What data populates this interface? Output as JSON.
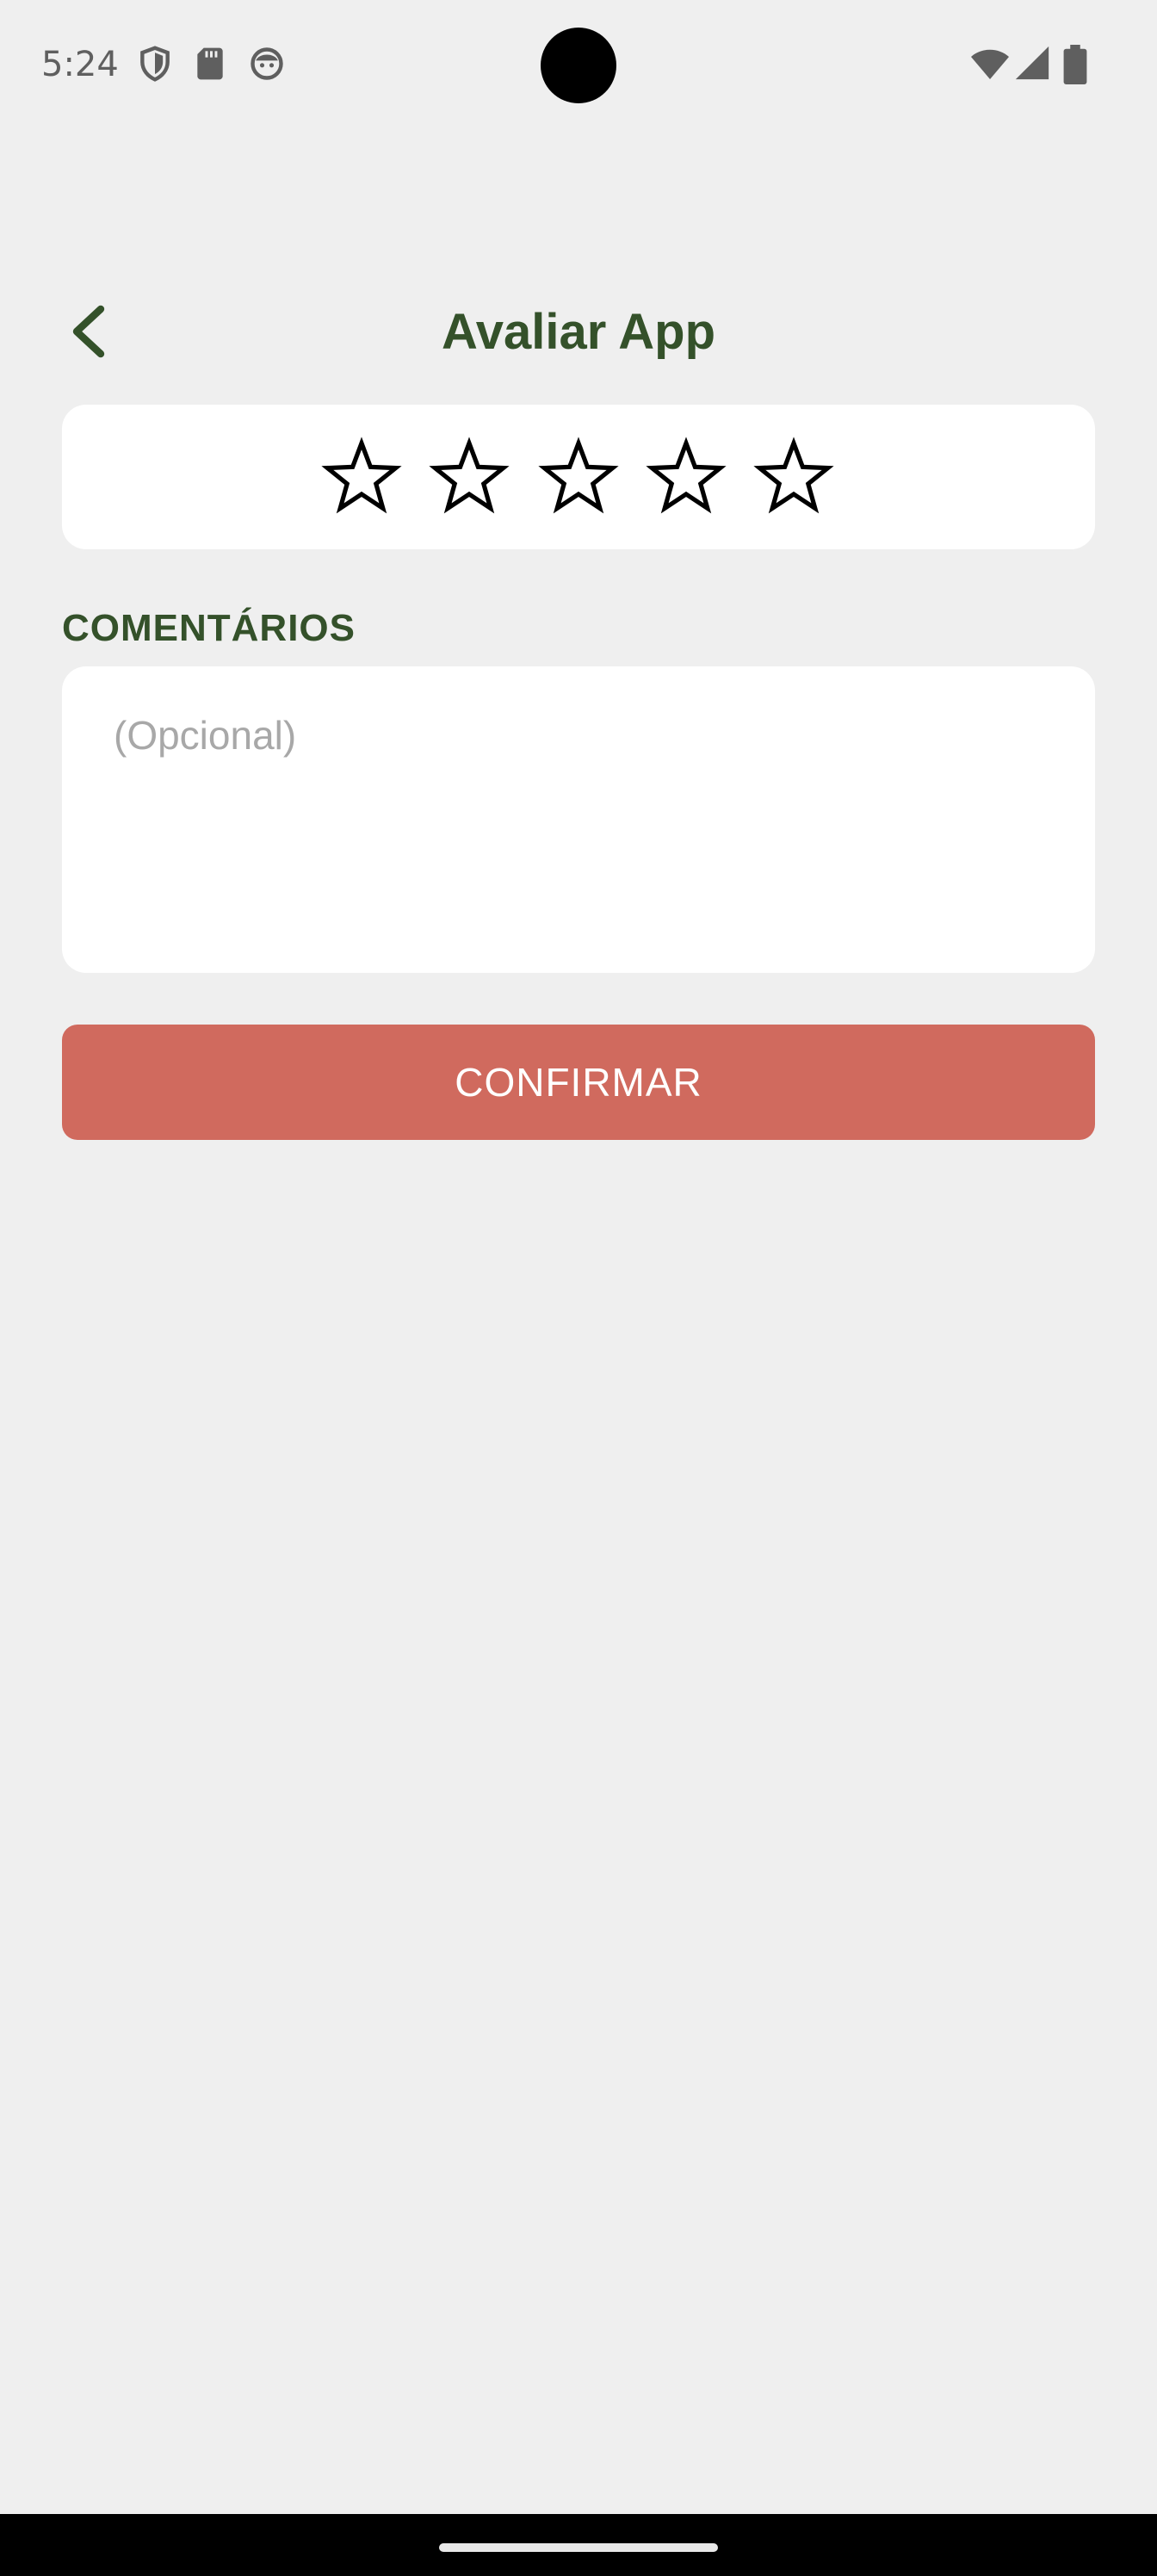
{
  "status_bar": {
    "time": "5:24",
    "left_icons": [
      "shield-icon",
      "sd-card-icon",
      "face-icon"
    ],
    "right_icons": [
      "wifi-icon",
      "signal-icon",
      "battery-icon"
    ]
  },
  "header": {
    "back_icon": "chevron-left-icon",
    "title": "Avaliar App"
  },
  "rating": {
    "max_stars": 5,
    "selected": 0
  },
  "comments": {
    "label": "COMENTÁRIOS",
    "placeholder": "(Opcional)",
    "value": ""
  },
  "confirm_button": {
    "label": "CONFIRMAR"
  },
  "colors": {
    "title": "#34512a",
    "confirm_button": "#d06a5e",
    "background": "#efefef",
    "card": "#ffffff"
  }
}
